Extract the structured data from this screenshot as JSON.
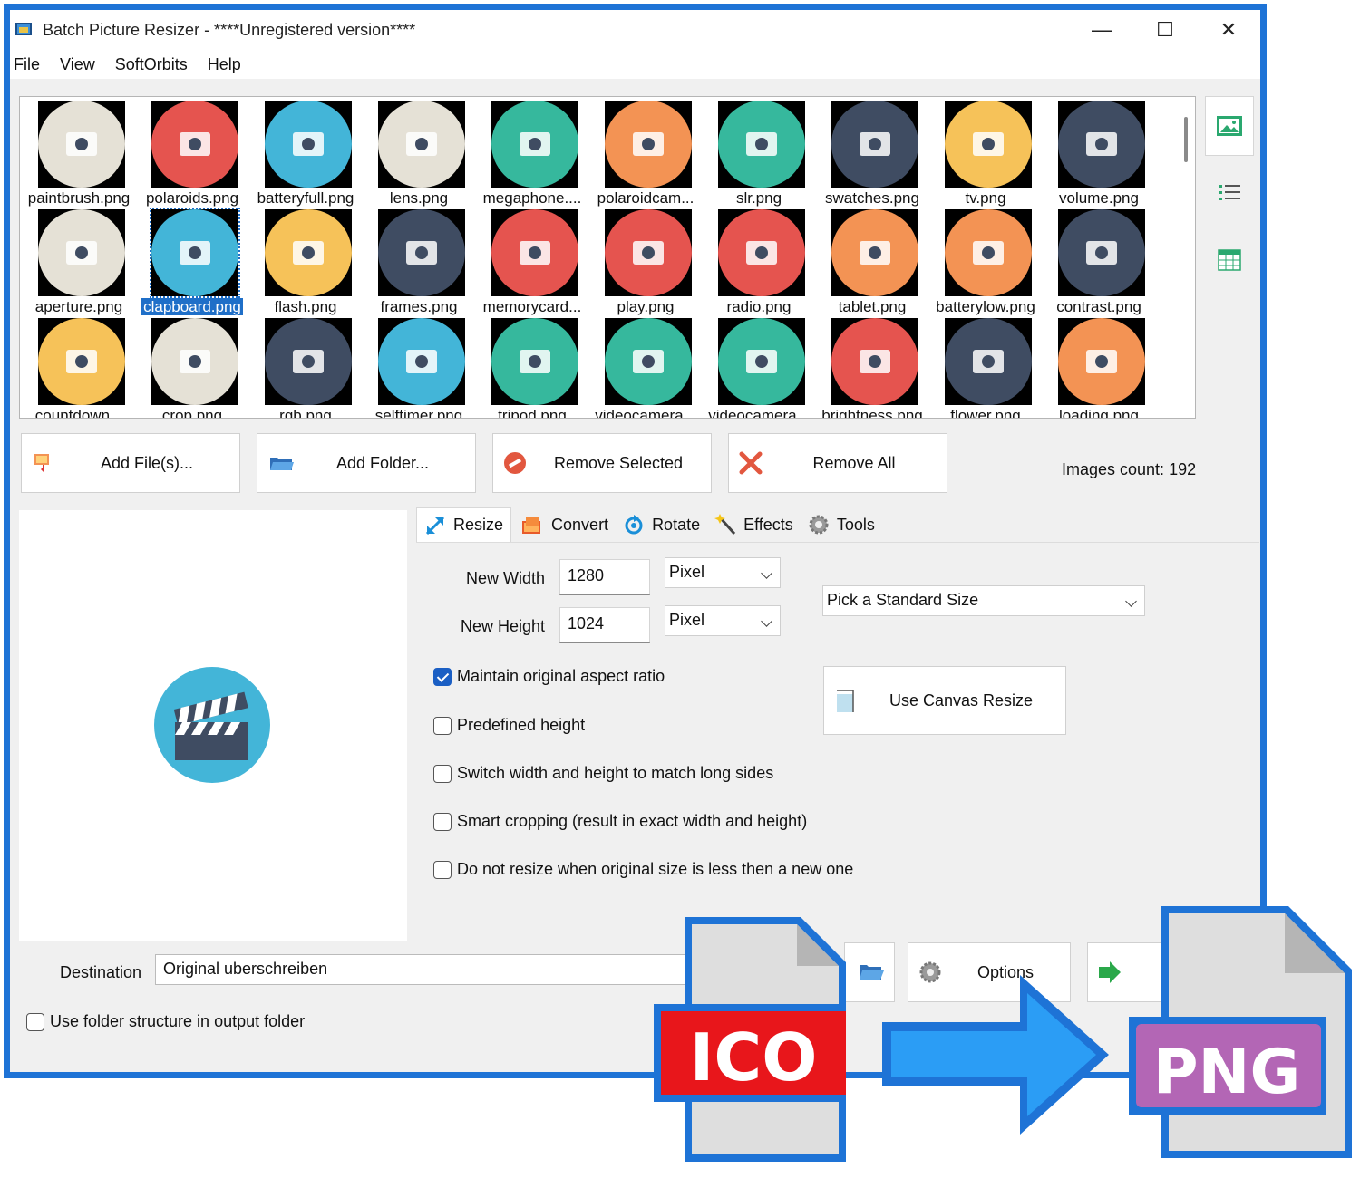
{
  "window": {
    "title": "Batch Picture Resizer - ****Unregistered version****",
    "controls": {
      "minimize": "—",
      "maximize": "☐",
      "close": "✕"
    }
  },
  "menu": [
    "File",
    "View",
    "SoftOrbits",
    "Help"
  ],
  "gallery": {
    "items": [
      {
        "label": "paintbrush.png",
        "color": "#e5e1d6"
      },
      {
        "label": "polaroids.png",
        "color": "#e5544f"
      },
      {
        "label": "batteryfull.png",
        "color": "#43b5d8"
      },
      {
        "label": "lens.png",
        "color": "#e5e1d6"
      },
      {
        "label": "megaphone....",
        "color": "#36b89d"
      },
      {
        "label": "polaroidcam...",
        "color": "#f39354"
      },
      {
        "label": "slr.png",
        "color": "#36b89d"
      },
      {
        "label": "swatches.png",
        "color": "#3f4c62"
      },
      {
        "label": "tv.png",
        "color": "#f6c259"
      },
      {
        "label": "volume.png",
        "color": "#3f4c62"
      },
      {
        "label": "aperture.png",
        "color": "#e5e1d6"
      },
      {
        "label": "clapboard.png",
        "color": "#43b5d8",
        "selected": true
      },
      {
        "label": "flash.png",
        "color": "#f6c259"
      },
      {
        "label": "frames.png",
        "color": "#3f4c62"
      },
      {
        "label": "memorycard...",
        "color": "#e5544f"
      },
      {
        "label": "play.png",
        "color": "#e5544f"
      },
      {
        "label": "radio.png",
        "color": "#e5544f"
      },
      {
        "label": "tablet.png",
        "color": "#f39354"
      },
      {
        "label": "batterylow.png",
        "color": "#f39354"
      },
      {
        "label": "contrast.png",
        "color": "#3f4c62"
      },
      {
        "label": "countdown...",
        "color": "#f6c259"
      },
      {
        "label": "crop.png",
        "color": "#e5e1d6"
      },
      {
        "label": "rgb.png",
        "color": "#3f4c62"
      },
      {
        "label": "selftimer.png",
        "color": "#43b5d8"
      },
      {
        "label": "tripod.png",
        "color": "#36b89d"
      },
      {
        "label": "videocamera...",
        "color": "#36b89d"
      },
      {
        "label": "videocamera...",
        "color": "#36b89d"
      },
      {
        "label": "brightness.png",
        "color": "#e5544f"
      },
      {
        "label": "flower.png",
        "color": "#3f4c62"
      },
      {
        "label": "loading.png",
        "color": "#f39354"
      }
    ]
  },
  "sidebar": {
    "items": [
      {
        "icon": "thumbnails-view-icon"
      },
      {
        "icon": "list-view-icon"
      },
      {
        "icon": "grid-view-icon"
      }
    ]
  },
  "buttons": {
    "add_files": "Add File(s)...",
    "add_folder": "Add Folder...",
    "remove_selected": "Remove Selected",
    "remove_all": "Remove All"
  },
  "images_count": "Images count: 192",
  "tabs": [
    "Resize",
    "Convert",
    "Rotate",
    "Effects",
    "Tools"
  ],
  "resize": {
    "new_width_label": "New Width",
    "new_width": "1280",
    "new_height_label": "New Height",
    "new_height": "1024",
    "width_unit": "Pixel",
    "height_unit": "Pixel",
    "standard_size": "Pick a Standard Size",
    "canvas_button": "Use Canvas Resize",
    "options": [
      {
        "label": "Maintain original aspect ratio",
        "checked": true
      },
      {
        "label": "Predefined height",
        "checked": false
      },
      {
        "label": "Switch width and height to match long sides",
        "checked": false
      },
      {
        "label": "Smart cropping (result in exact width and height)",
        "checked": false
      },
      {
        "label": "Do not resize when original size is less then a new one",
        "checked": false
      }
    ]
  },
  "destination": {
    "label": "Destination",
    "value": "Original uberschreiben",
    "options_button": "Options",
    "folder_structure": "Use folder structure in output folder"
  },
  "promo": {
    "from_format": "ICO",
    "to_format": "PNG",
    "from_color": "#e8161b",
    "to_color": "#b366b5",
    "frame_color": "#1e73d6"
  }
}
